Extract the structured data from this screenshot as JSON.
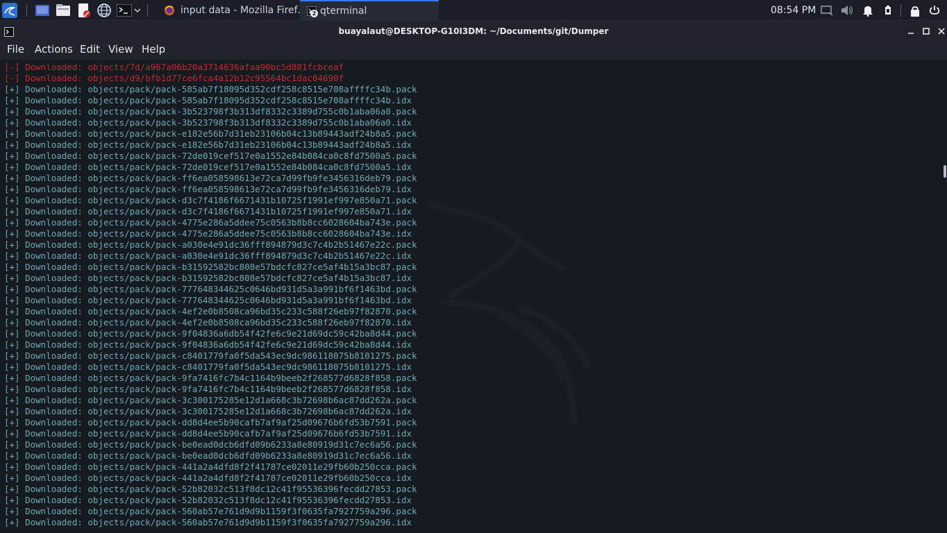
{
  "taskbar": {
    "tasks": [
      {
        "label": "input data - Mozilla Firef…",
        "icon": "firefox-icon"
      },
      {
        "label": "qterminal",
        "icon": "terminal-icon",
        "badge": "2"
      }
    ],
    "clock": "08:54 PM"
  },
  "window": {
    "title": "buayalaut@DESKTOP-G10I3DM: ~/Documents/git/Dumper"
  },
  "menu": [
    "File",
    "Actions",
    "Edit",
    "View",
    "Help"
  ],
  "terminal": {
    "lines": [
      {
        "text": "[-] Downloaded: objects/7d/a967a06b20a3714636afaa90bc5d881fcbceaf",
        "status": "error"
      },
      {
        "text": "[-] Downloaded: objects/d9/bfb1d77ce6fca4a12b12c95564bc1dac04690f",
        "status": "error"
      },
      {
        "text": "[+] Downloaded: objects/pack/pack-585ab7f18095d352cdf258c8515e708affffc34b.pack",
        "status": "ok"
      },
      {
        "text": "[+] Downloaded: objects/pack/pack-585ab7f18095d352cdf258c8515e708affffc34b.idx",
        "status": "ok"
      },
      {
        "text": "[+] Downloaded: objects/pack/pack-3b523798f3b313df8332c3389d755c0b1aba06a0.pack",
        "status": "ok"
      },
      {
        "text": "[+] Downloaded: objects/pack/pack-3b523798f3b313df8332c3389d755c0b1aba06a0.idx",
        "status": "ok"
      },
      {
        "text": "[+] Downloaded: objects/pack/pack-e182e56b7d31eb23106b04c13b89443adf24b8a5.pack",
        "status": "ok"
      },
      {
        "text": "[+] Downloaded: objects/pack/pack-e182e56b7d31eb23106b04c13b89443adf24b8a5.idx",
        "status": "ok"
      },
      {
        "text": "[+] Downloaded: objects/pack/pack-72de019cef517e0a1552e84b084ca0c8fd7500a5.pack",
        "status": "ok"
      },
      {
        "text": "[+] Downloaded: objects/pack/pack-72de019cef517e0a1552e84b084ca0c8fd7500a5.idx",
        "status": "ok"
      },
      {
        "text": "[+] Downloaded: objects/pack/pack-ff6ea058598613e72ca7d99fb9fe3456316deb79.pack",
        "status": "ok"
      },
      {
        "text": "[+] Downloaded: objects/pack/pack-ff6ea058598613e72ca7d99fb9fe3456316deb79.idx",
        "status": "ok"
      },
      {
        "text": "[+] Downloaded: objects/pack/pack-d3c7f4186f6671431b10725f1991ef997e850a71.pack",
        "status": "ok"
      },
      {
        "text": "[+] Downloaded: objects/pack/pack-d3c7f4186f6671431b10725f1991ef997e850a71.idx",
        "status": "ok"
      },
      {
        "text": "[+] Downloaded: objects/pack/pack-4775e286a5ddee75c0563b8b8cc6028604ba743e.pack",
        "status": "ok"
      },
      {
        "text": "[+] Downloaded: objects/pack/pack-4775e286a5ddee75c0563b8b8cc6028604ba743e.idx",
        "status": "ok"
      },
      {
        "text": "[+] Downloaded: objects/pack/pack-a030e4e91dc36fff894879d3c7c4b2b51467e22c.pack",
        "status": "ok"
      },
      {
        "text": "[+] Downloaded: objects/pack/pack-a030e4e91dc36fff894879d3c7c4b2b51467e22c.idx",
        "status": "ok"
      },
      {
        "text": "[+] Downloaded: objects/pack/pack-b31592582bc808e57bdcfc827ce5af4b15a3bc87.pack",
        "status": "ok"
      },
      {
        "text": "[+] Downloaded: objects/pack/pack-b31592582bc808e57bdcfc827ce5af4b15a3bc87.idx",
        "status": "ok"
      },
      {
        "text": "[+] Downloaded: objects/pack/pack-777648344625c0646bd931d5a3a991bf6f1463bd.pack",
        "status": "ok"
      },
      {
        "text": "[+] Downloaded: objects/pack/pack-777648344625c0646bd931d5a3a991bf6f1463bd.idx",
        "status": "ok"
      },
      {
        "text": "[+] Downloaded: objects/pack/pack-4ef2e0b8508ca96bd35c233c588f26eb97f82870.pack",
        "status": "ok"
      },
      {
        "text": "[+] Downloaded: objects/pack/pack-4ef2e0b8508ca96bd35c233c588f26eb97f82870.idx",
        "status": "ok"
      },
      {
        "text": "[+] Downloaded: objects/pack/pack-9f04836a6db54f42fe6c9e21d69dc59c42ba8d44.pack",
        "status": "ok"
      },
      {
        "text": "[+] Downloaded: objects/pack/pack-9f04836a6db54f42fe6c9e21d69dc59c42ba8d44.idx",
        "status": "ok"
      },
      {
        "text": "[+] Downloaded: objects/pack/pack-c8401779fa0f5da543ec9dc986118075b8101275.pack",
        "status": "ok"
      },
      {
        "text": "[+] Downloaded: objects/pack/pack-c8401779fa0f5da543ec9dc986118075b8101275.idx",
        "status": "ok"
      },
      {
        "text": "[+] Downloaded: objects/pack/pack-9fa7416fc7b4c1164b9beeb2f268577d6828f858.pack",
        "status": "ok"
      },
      {
        "text": "[+] Downloaded: objects/pack/pack-9fa7416fc7b4c1164b9beeb2f268577d6828f858.idx",
        "status": "ok"
      },
      {
        "text": "[+] Downloaded: objects/pack/pack-3c300175285e12d1a668c3b72698b6ac87dd262a.pack",
        "status": "ok"
      },
      {
        "text": "[+] Downloaded: objects/pack/pack-3c300175285e12d1a668c3b72698b6ac87dd262a.idx",
        "status": "ok"
      },
      {
        "text": "[+] Downloaded: objects/pack/pack-dd8d4ee5b90cafb7af9af25d09676b6fd53b7591.pack",
        "status": "ok"
      },
      {
        "text": "[+] Downloaded: objects/pack/pack-dd8d4ee5b90cafb7af9af25d09676b6fd53b7591.idx",
        "status": "ok"
      },
      {
        "text": "[+] Downloaded: objects/pack/pack-be0ead0dcb6dfd09b6233a8e80919d31c7ec6a56.pack",
        "status": "ok"
      },
      {
        "text": "[+] Downloaded: objects/pack/pack-be0ead0dcb6dfd09b6233a8e80919d31c7ec6a56.idx",
        "status": "ok"
      },
      {
        "text": "[+] Downloaded: objects/pack/pack-441a2a4dfd8f2f41787ce02011e29fb60b250cca.pack",
        "status": "ok"
      },
      {
        "text": "[+] Downloaded: objects/pack/pack-441a2a4dfd8f2f41787ce02011e29fb60b250cca.idx",
        "status": "ok"
      },
      {
        "text": "[+] Downloaded: objects/pack/pack-52b82032c513f8dc12c41f95536396fecdd27853.pack",
        "status": "ok"
      },
      {
        "text": "[+] Downloaded: objects/pack/pack-52b82032c513f8dc12c41f95536396fecdd27853.idx",
        "status": "ok"
      },
      {
        "text": "[+] Downloaded: objects/pack/pack-560ab57e761d9d9b1159f3f0635fa7927759a296.pack",
        "status": "ok"
      },
      {
        "text": "[+] Downloaded: objects/pack/pack-560ab57e761d9d9b1159f3f0635fa7927759a296.idx",
        "status": "ok"
      }
    ]
  },
  "colors": {
    "ok_text": "#6fa9b4",
    "error_text": "#c42a2a",
    "terminal_bg": "#161a21",
    "accent": "#367bf0"
  }
}
